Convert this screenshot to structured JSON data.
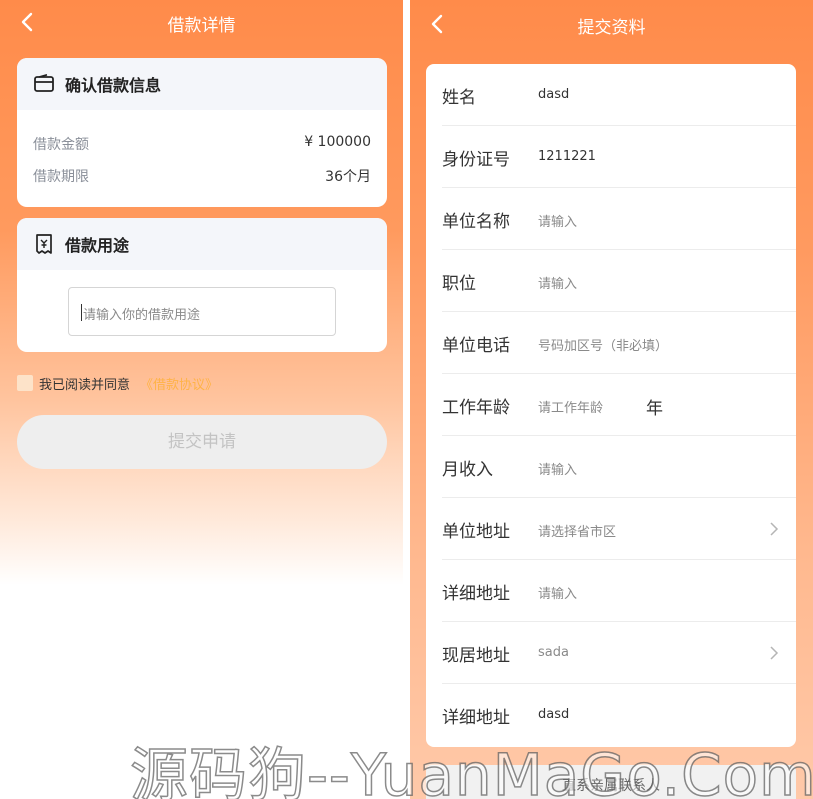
{
  "left": {
    "nav": {
      "title": "借款详情"
    },
    "confirm_card": {
      "title": "确认借款信息",
      "rows": [
        {
          "label": "借款金额",
          "value": "¥ 100000"
        },
        {
          "label": "借款期限",
          "value": "36个月"
        }
      ]
    },
    "purpose_card": {
      "title": "借款用途",
      "placeholder": "请输入你的借款用途"
    },
    "agree": {
      "text": "我已阅读并同意",
      "link": "《借款协议》"
    },
    "submit_label": "提交申请"
  },
  "right": {
    "nav": {
      "title": "提交资料"
    },
    "fields": [
      {
        "label": "姓名",
        "value": "dasd",
        "placeholder": false
      },
      {
        "label": "身份证号",
        "value": "1211221",
        "placeholder": false
      },
      {
        "label": "单位名称",
        "value": "请输入",
        "placeholder": true
      },
      {
        "label": "职位",
        "value": "请输入",
        "placeholder": true
      },
      {
        "label": "单位电话",
        "value": "号码加区号（非必填）",
        "placeholder": true
      },
      {
        "label": "工作年龄",
        "value": "请工作年龄",
        "placeholder": true,
        "unit": "年"
      },
      {
        "label": "月收入",
        "value": "请输入",
        "placeholder": true
      },
      {
        "label": "单位地址",
        "value": "请选择省市区",
        "placeholder": true,
        "chevron": true
      },
      {
        "label": "详细地址",
        "value": "请输入",
        "placeholder": true
      },
      {
        "label": "现居地址",
        "value": "sada",
        "placeholder": true,
        "chevron": true
      },
      {
        "label": "详细地址",
        "value": "dasd",
        "placeholder": false
      }
    ],
    "bottom_button": "直系亲属联系人"
  },
  "watermark": "源码狗--YuanMaGo.Com",
  "colors": {
    "orange": "#ff8b4a",
    "link": "#ffb347",
    "disabled_btn": "#eeeeee"
  }
}
